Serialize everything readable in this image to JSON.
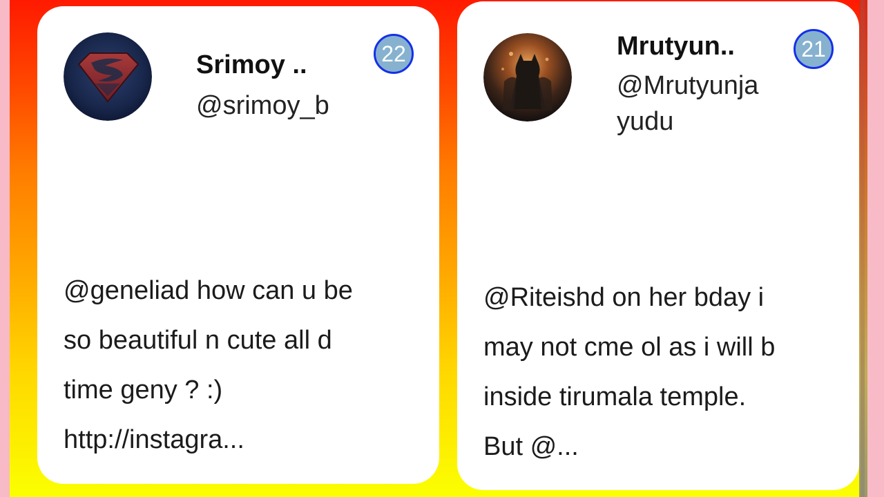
{
  "cards": [
    {
      "name": "Srimoy ..",
      "handle": "@srimoy_b",
      "badge": "22",
      "avatar_icon": "superman-logo-avatar",
      "tweet": "@geneliad how can u be\nso beautiful n cute all d\ntime geny ? :)\nhttp://instagra..."
    },
    {
      "name": "Mrutyun..",
      "handle": "@Mrutyunja\nyudu",
      "badge": "21",
      "avatar_icon": "batman-avatar",
      "tweet": "@Riteishd on her bday i\nmay not cme ol as i will b\ninside tirumala temple.\nBut @..."
    }
  ],
  "colors": {
    "gradient_top": "#ff1a00",
    "gradient_bottom": "#fbff00",
    "side_pink": "#f7bac6",
    "badge_fill": "#86b2cf",
    "badge_border": "#1430e8"
  }
}
